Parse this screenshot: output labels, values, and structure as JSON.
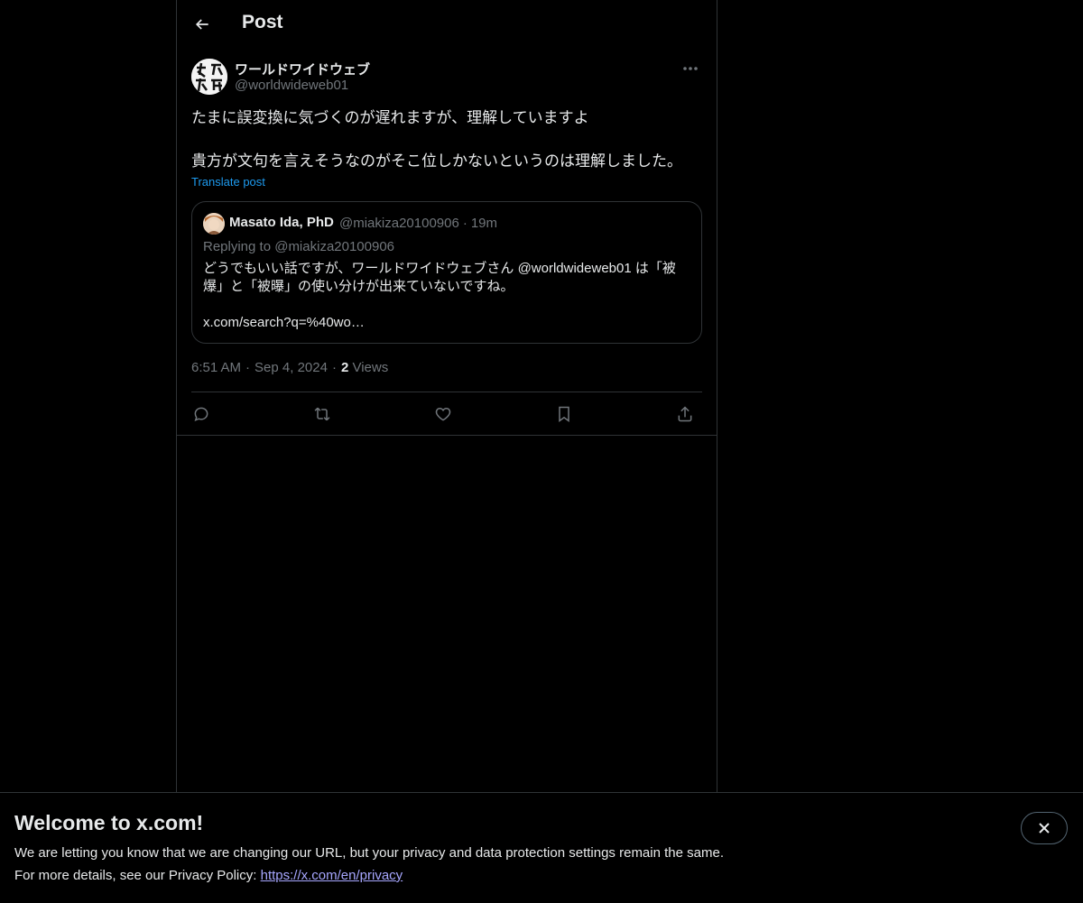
{
  "header": {
    "title": "Post"
  },
  "post": {
    "author_name": "ワールドワイドウェブ",
    "author_handle": "@worldwideweb01",
    "text_line1": "たまに誤変換に気づくのが遅れますが、理解していますよ",
    "text_line2": "貴方が文句を言えそうなのがそこ位しかないというのは理解しました。",
    "translate_label": "Translate post",
    "time": "6:51 AM",
    "date": "Sep 4, 2024",
    "views_count": "2",
    "views_label": "Views"
  },
  "quote": {
    "author_name": "Masato Ida, PhD",
    "author_handle": "@miakiza20100906",
    "time_ago": "19m",
    "replying_to": "Replying to @miakiza20100906",
    "body_line1": "どうでもいい話ですが、ワールドワイドウェブさん @worldwideweb01 は「被",
    "body_line2": "爆」と「被曝」の使い分けが出来ていないですね。",
    "link": "x.com/search?q=%40wo…"
  },
  "banner": {
    "title": "Welcome to x.com!",
    "line1": "We are letting you know that we are changing our URL, but your privacy and data protection settings remain the same.",
    "line2_prefix": "For more details, see our Privacy Policy:",
    "link": "https://x.com/en/privacy"
  },
  "colors": {
    "background": "#000000",
    "text": "#e7e9ea",
    "muted": "#71767b",
    "accent": "#1d9bf0",
    "border": "#2f3336",
    "link_visited": "#a7a7ff"
  },
  "icons": [
    "back-arrow-icon",
    "more-icon",
    "reply-icon",
    "repost-icon",
    "like-icon",
    "bookmark-icon",
    "share-icon",
    "close-icon"
  ]
}
